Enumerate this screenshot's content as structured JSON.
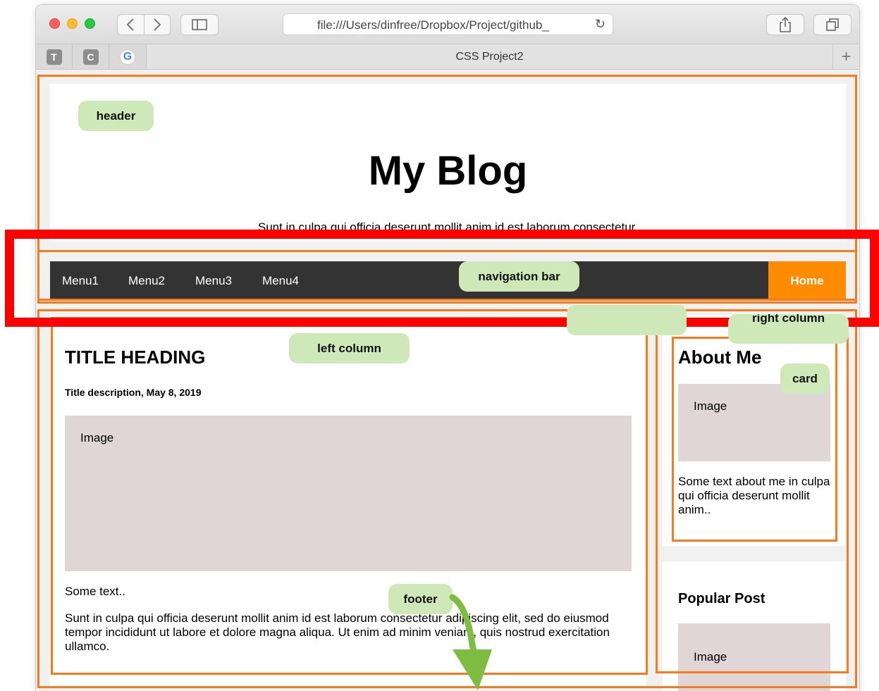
{
  "browser": {
    "url": "file:///Users/dinfree/Dropbox/Project/github_",
    "tab_title": "CSS Project2",
    "favicons": [
      {
        "letter": "T",
        "icon": "t-favicon-icon"
      },
      {
        "letter": "C",
        "icon": "c-favicon-icon"
      },
      {
        "letter": "G",
        "icon": "google-favicon-icon"
      }
    ],
    "new_tab_glyph": "+"
  },
  "header": {
    "title": "My Blog",
    "subtitle": "Sunt in culpa qui officia deserunt mollit anim id est laborum consectetur."
  },
  "nav": {
    "items": [
      "Menu1",
      "Menu2",
      "Menu3",
      "Menu4"
    ],
    "home": "Home"
  },
  "left_column": {
    "heading": "TITLE HEADING",
    "description": "Title description, May 8, 2019",
    "image_label": "Image",
    "short_text": "Some text..",
    "paragraph": "Sunt in culpa qui officia deserunt mollit anim id est laborum consectetur adipiscing elit, sed do eiusmod tempor incididunt ut labore et dolore magna aliqua. Ut enim ad minim veniam, quis nostrud exercitation ullamco."
  },
  "right_column": {
    "about_title": "About Me",
    "about_image_label": "Image",
    "about_text": "Some text about me in culpa qui officia deserunt mollit anim..",
    "popular_title": "Popular Post",
    "popular_image_label": "Image"
  },
  "annotations": {
    "header": "header",
    "navigation_bar": "navigation bar",
    "left_column": "left column",
    "right_column": "right column",
    "card": "card",
    "footer": "footer"
  },
  "colors": {
    "nav_background": "#333333",
    "home_accent": "#ff8c00",
    "image_placeholder": "#e0d6d6",
    "annotation_orange": "#f77a1c",
    "annotation_red": "#ff0000",
    "annotation_tag": "#cfe8b7",
    "arrow_green": "#7dbd42"
  }
}
